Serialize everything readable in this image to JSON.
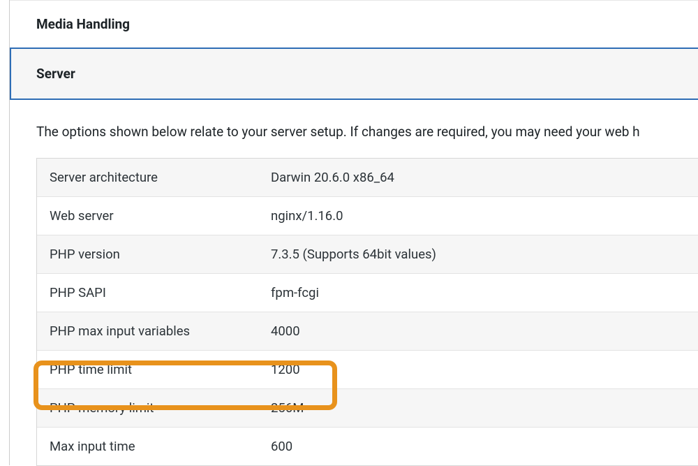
{
  "sections": {
    "media_handling": "Media Handling",
    "server": "Server"
  },
  "description": "The options shown below relate to your server setup. If changes are required, you may need your web h",
  "table": {
    "rows": [
      {
        "label": "Server architecture",
        "value": "Darwin 20.6.0 x86_64"
      },
      {
        "label": "Web server",
        "value": "nginx/1.16.0"
      },
      {
        "label": "PHP version",
        "value": "7.3.5 (Supports 64bit values)"
      },
      {
        "label": "PHP SAPI",
        "value": "fpm-fcgi"
      },
      {
        "label": "PHP max input variables",
        "value": "4000"
      },
      {
        "label": "PHP time limit",
        "value": "1200"
      },
      {
        "label": "PHP memory limit",
        "value": "256M"
      },
      {
        "label": "Max input time",
        "value": "600"
      }
    ]
  }
}
